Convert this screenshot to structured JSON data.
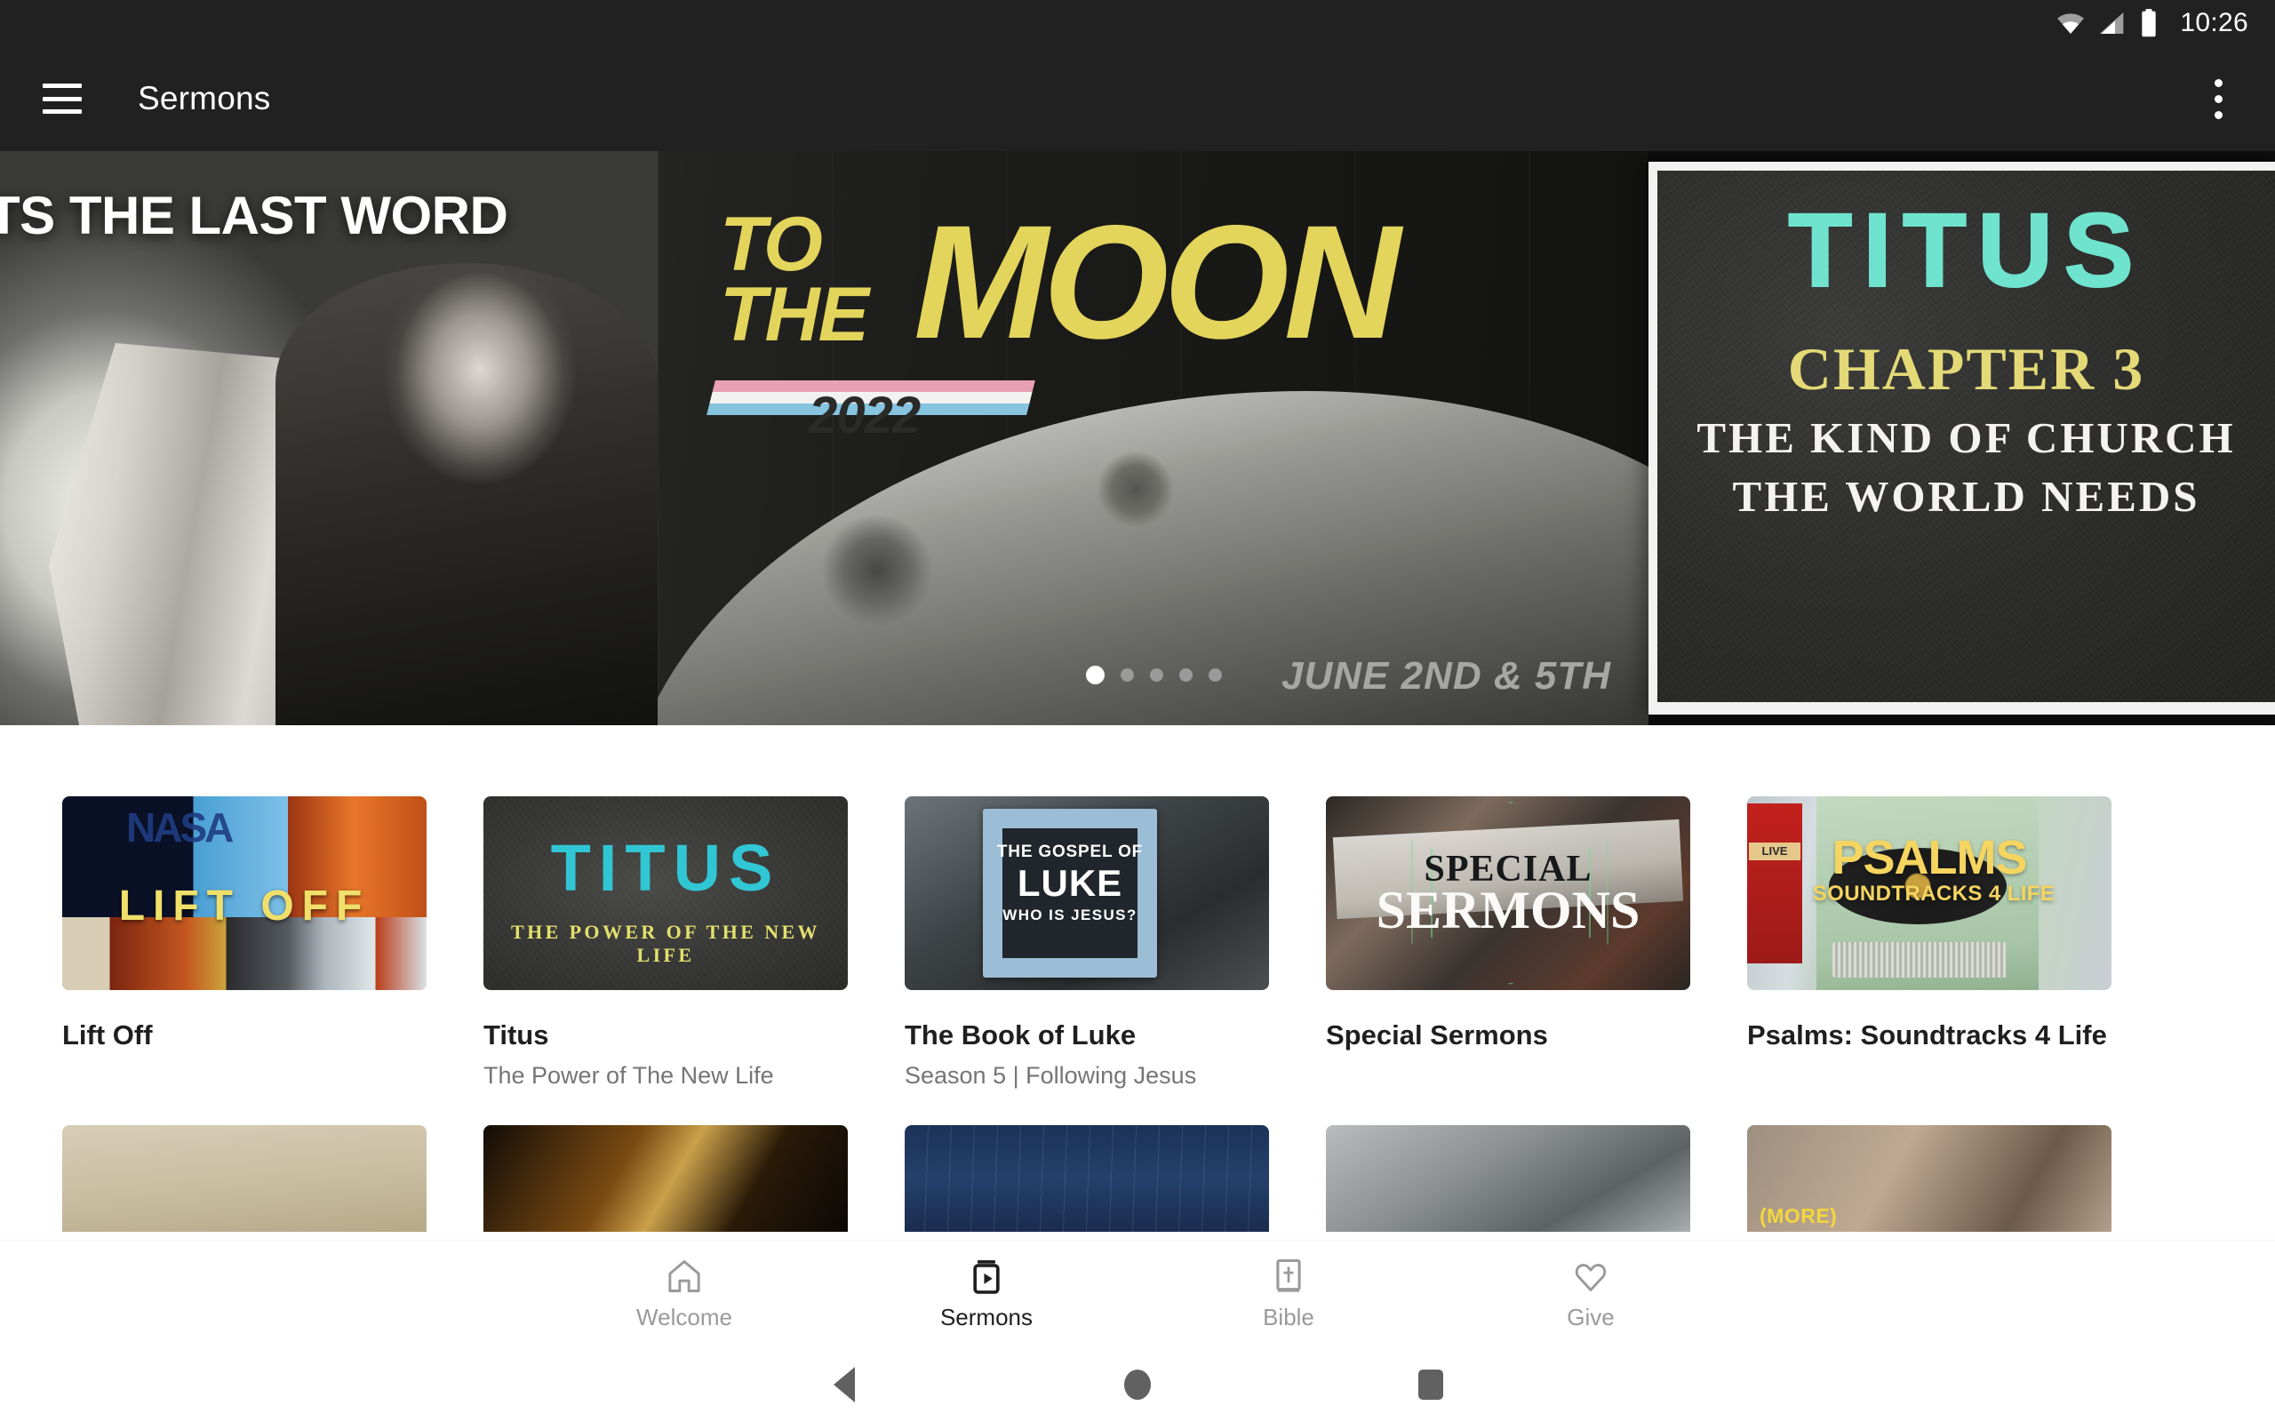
{
  "status_bar": {
    "time": "10:26",
    "icons": [
      "wifi-icon",
      "cellular-signal-icon",
      "battery-icon"
    ]
  },
  "app_bar": {
    "menu_icon": "hamburger-menu-icon",
    "title": "Sermons",
    "overflow_icon": "overflow-menu-icon"
  },
  "hero": {
    "left_slide": {
      "title": "TS THE LAST WORD"
    },
    "moon_slide": {
      "line1": "TO",
      "line2": "THE",
      "big": "MOON",
      "year": "2022",
      "date": "JUNE 2ND & 5TH",
      "accent_color": "#e3d45c",
      "stripe_colors": [
        "#e8a0b4",
        "#f2f2f2",
        "#86c4e0"
      ]
    },
    "peek_slide": {
      "series": "TITUS",
      "chapter": "CHAPTER 3",
      "line1": "THE KIND OF CHURCH",
      "line2": "THE WORLD NEEDS",
      "series_color": "#6fe3cd",
      "chapter_color": "#e3d977"
    },
    "dots": {
      "count": 5,
      "active_index": 0
    }
  },
  "cards": [
    {
      "title": "Lift Off",
      "subtitle": "",
      "thumb": {
        "kind": "liftoff",
        "overlay_text": "LIFT OFF",
        "brand": "NASA"
      }
    },
    {
      "title": "Titus",
      "subtitle": "The Power of The New Life",
      "thumb": {
        "kind": "titus",
        "main": "TITUS",
        "sub": "THE POWER OF THE NEW LIFE"
      }
    },
    {
      "title": "The Book of Luke",
      "subtitle": "Season 5 | Following Jesus",
      "thumb": {
        "kind": "luke",
        "line1": "THE GOSPEL OF",
        "line2": "LUKE",
        "line3": "WHO IS JESUS?"
      }
    },
    {
      "title": "Special Sermons",
      "subtitle": "",
      "thumb": {
        "kind": "special",
        "line1": "SPECIAL",
        "line2": "SERMONS"
      }
    },
    {
      "title": "Psalms: Soundtracks 4 Life",
      "subtitle": "",
      "thumb": {
        "kind": "psalms",
        "line1": "PSALMS",
        "line2": "SOUNDTRACKS 4 LIFE",
        "badge": "LIVE"
      }
    }
  ],
  "cards_row2": [
    {
      "thumb_kind": "wood"
    },
    {
      "thumb_kind": "dark-orange"
    },
    {
      "thumb_kind": "navy"
    },
    {
      "thumb_kind": "concrete"
    },
    {
      "thumb_kind": "more",
      "overlay_text": "(MORE)"
    }
  ],
  "bottom_nav": {
    "items": [
      {
        "label": "Welcome",
        "icon": "home-icon",
        "active": false
      },
      {
        "label": "Sermons",
        "icon": "video-library-icon",
        "active": true
      },
      {
        "label": "Bible",
        "icon": "bible-book-icon",
        "active": false
      },
      {
        "label": "Give",
        "icon": "heart-icon",
        "active": false
      }
    ]
  },
  "android_nav": {
    "back": "back-triangle-icon",
    "home": "home-circle-icon",
    "recents": "recents-square-icon"
  }
}
